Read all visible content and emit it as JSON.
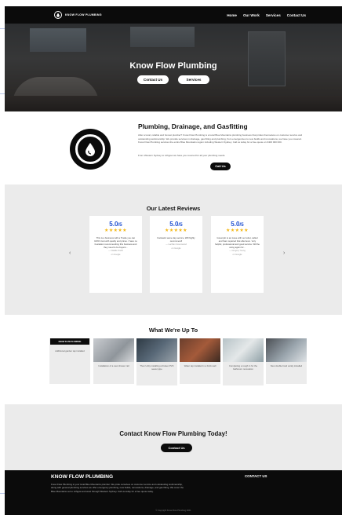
{
  "nav": {
    "brand": "KNOW FLOW PLUMBING",
    "links": [
      "Home",
      "Our Work",
      "Services",
      "Contact Us"
    ]
  },
  "hero": {
    "title": "Know Flow Plumbing",
    "buttons": [
      "Contact Us",
      "Services"
    ]
  },
  "about": {
    "title": "Plumbing, Drainage, and Gasfitting",
    "paragraph1": "After a local, reliable and honest plumber? Know Flow Plumbing is a local Blue Mountains plumbing business that prides themselves on customer service and outstanding workmanship. We provide services in drainage, gas fitting and plumbing, from emergencies to new builds and renovations, we have you covered. Know Flow Plumbing services the entire Blue Mountains region including Western Sydney. Call us today for a free quote on 0400 000 000.",
    "paragraph2": "From Western Sydney to Lithgow we have you covered for all your plumbing needs.",
    "button": "Call Us"
  },
  "reviews": {
    "title": "Our Latest Reviews",
    "prev": "‹",
    "next": "›",
    "items": [
      {
        "score": "5.0",
        "out_of": "/5",
        "stars": "★★★★★",
        "text": "This is a business with a Tradie you can 100% trust with quality and prices. I have no hesitation recommending this business and they need to be buyers...",
        "author": "— Natalie Smith",
        "source": "on Google"
      },
      {
        "score": "5.0",
        "out_of": "/5",
        "stars": "★★★★★",
        "text": "Fantastic same day service. Will highly recommend!",
        "author": "— Lachlan Greenwood",
        "source": "on Google"
      },
      {
        "score": "5.0",
        "out_of": "/5",
        "stars": "★★★★★",
        "text": "Great job to an issue with our toilet, called and Sam repaired that afternoon. Very helpful, professional and good service. Will be using again for...",
        "author": "— Gregory Young",
        "source": "on Google"
      }
    ]
  },
  "projects": {
    "title": "What We're Up To",
    "items": [
      {
        "caption": "Additional garden tap installed",
        "label": "KNOW FLOW PLUMBING"
      },
      {
        "caption": "Installation of a new shower rail"
      },
      {
        "caption": "Then Unity installing a broken PVC sewer pipe"
      },
      {
        "caption": "Water tap installed in a brick wall"
      },
      {
        "caption": "Completing a rough in for the bathroom renovation"
      },
      {
        "caption": "New double bowl vanity installed"
      }
    ]
  },
  "contact": {
    "title": "Contact Know Flow Plumbing Today!",
    "button": "Contact Us"
  },
  "footer": {
    "brand": "KNOW FLOW PLUMBING",
    "text": "Know Flow Plumbing is your local Blue Mountains plumber. We pride ourselves on customer service and outstanding workmanship, along with general plumbing services we offer emergency plumbing, new builds, renovations, drainage, and gas fitting. We cover the Blue Mountains out to Lithgow and west through Western Sydney. Call us today for a free quote today.",
    "contact_heading": "CONTACT US",
    "copyright": "© Copyright Know Flow Plumbing 2021"
  },
  "colors": {
    "dark": "#0b0b0b",
    "score_blue": "#1f4fd1",
    "star_gold": "#f3b714",
    "section_grey": "#ebebeb"
  }
}
